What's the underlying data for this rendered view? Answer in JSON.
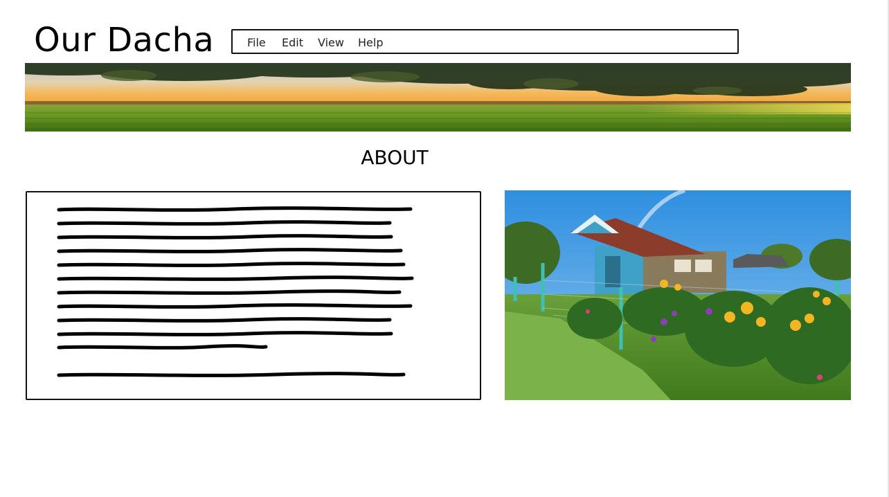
{
  "header": {
    "site_title": "Our Dacha"
  },
  "menubar": {
    "items": [
      "File",
      "Edit",
      "View",
      "Help"
    ]
  },
  "banner": {
    "icon": "landscape-banner-image"
  },
  "about": {
    "heading": "ABOUT",
    "placeholder_paragraphs": 2,
    "photo_icon": "dacha-house-photo"
  },
  "colors": {
    "text": "#000000",
    "border": "#111111",
    "sky_blue": "#2f8fe0",
    "field_green": "#5b8a1f",
    "sunset_gold": "#f0b23a"
  }
}
